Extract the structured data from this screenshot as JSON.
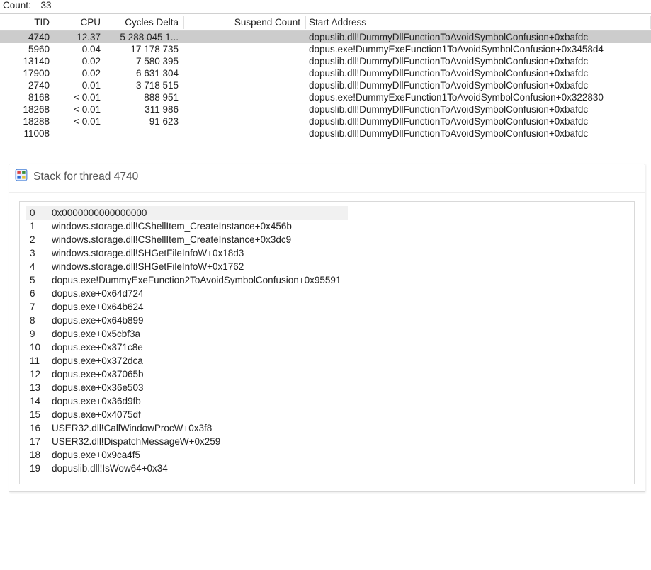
{
  "count": {
    "label": "Count:",
    "value": "33"
  },
  "thread_headers": {
    "tid": "TID",
    "cpu": "CPU",
    "cycles": "Cycles Delta",
    "suspend": "Suspend Count",
    "start": "Start Address"
  },
  "threads": [
    {
      "tid": "4740",
      "cpu": "12.37",
      "cycles": "5 288 045 1...",
      "suspend": "",
      "start": "dopuslib.dll!DummyDllFunctionToAvoidSymbolConfusion+0xbafdc",
      "selected": true
    },
    {
      "tid": "5960",
      "cpu": "0.04",
      "cycles": "17 178 735",
      "suspend": "",
      "start": "dopus.exe!DummyExeFunction1ToAvoidSymbolConfusion+0x3458d4"
    },
    {
      "tid": "13140",
      "cpu": "0.02",
      "cycles": "7 580 395",
      "suspend": "",
      "start": "dopuslib.dll!DummyDllFunctionToAvoidSymbolConfusion+0xbafdc"
    },
    {
      "tid": "17900",
      "cpu": "0.02",
      "cycles": "6 631 304",
      "suspend": "",
      "start": "dopuslib.dll!DummyDllFunctionToAvoidSymbolConfusion+0xbafdc"
    },
    {
      "tid": "2740",
      "cpu": "0.01",
      "cycles": "3 718 515",
      "suspend": "",
      "start": "dopuslib.dll!DummyDllFunctionToAvoidSymbolConfusion+0xbafdc"
    },
    {
      "tid": "8168",
      "cpu": "< 0.01",
      "cycles": "888 951",
      "suspend": "",
      "start": "dopus.exe!DummyExeFunction1ToAvoidSymbolConfusion+0x322830"
    },
    {
      "tid": "18268",
      "cpu": "< 0.01",
      "cycles": "311 986",
      "suspend": "",
      "start": "dopuslib.dll!DummyDllFunctionToAvoidSymbolConfusion+0xbafdc"
    },
    {
      "tid": "18288",
      "cpu": "< 0.01",
      "cycles": "91 623",
      "suspend": "",
      "start": "dopuslib.dll!DummyDllFunctionToAvoidSymbolConfusion+0xbafdc"
    },
    {
      "tid": "11008",
      "cpu": "",
      "cycles": "",
      "suspend": "",
      "start": "dopuslib.dll!DummyDllFunctionToAvoidSymbolConfusion+0xbafdc"
    }
  ],
  "stack": {
    "title_prefix": "Stack for thread",
    "thread_id": "4740",
    "frames": [
      {
        "idx": "0",
        "name": "0x0000000000000000",
        "selected": true
      },
      {
        "idx": "1",
        "name": "windows.storage.dll!CShellItem_CreateInstance+0x456b"
      },
      {
        "idx": "2",
        "name": "windows.storage.dll!CShellItem_CreateInstance+0x3dc9"
      },
      {
        "idx": "3",
        "name": "windows.storage.dll!SHGetFileInfoW+0x18d3"
      },
      {
        "idx": "4",
        "name": "windows.storage.dll!SHGetFileInfoW+0x1762"
      },
      {
        "idx": "5",
        "name": "dopus.exe!DummyExeFunction2ToAvoidSymbolConfusion+0x95591"
      },
      {
        "idx": "6",
        "name": "dopus.exe+0x64d724"
      },
      {
        "idx": "7",
        "name": "dopus.exe+0x64b624"
      },
      {
        "idx": "8",
        "name": "dopus.exe+0x64b899"
      },
      {
        "idx": "9",
        "name": "dopus.exe+0x5cbf3a"
      },
      {
        "idx": "10",
        "name": "dopus.exe+0x371c8e"
      },
      {
        "idx": "11",
        "name": "dopus.exe+0x372dca"
      },
      {
        "idx": "12",
        "name": "dopus.exe+0x37065b"
      },
      {
        "idx": "13",
        "name": "dopus.exe+0x36e503"
      },
      {
        "idx": "14",
        "name": "dopus.exe+0x36d9fb"
      },
      {
        "idx": "15",
        "name": "dopus.exe+0x4075df"
      },
      {
        "idx": "16",
        "name": "USER32.dll!CallWindowProcW+0x3f8"
      },
      {
        "idx": "17",
        "name": "USER32.dll!DispatchMessageW+0x259"
      },
      {
        "idx": "18",
        "name": "dopus.exe+0x9ca4f5"
      },
      {
        "idx": "19",
        "name": "dopuslib.dll!IsWow64+0x34"
      }
    ]
  }
}
